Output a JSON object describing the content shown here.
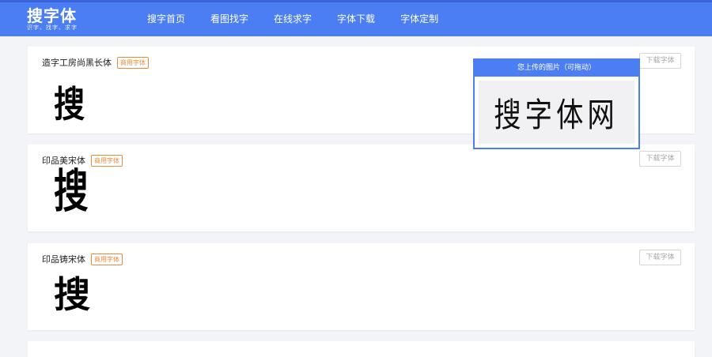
{
  "header": {
    "logo_main": "搜字体",
    "logo_sub": "识字、找字、求字",
    "nav": [
      "搜字首页",
      "看图找字",
      "在线求字",
      "字体下载",
      "字体定制"
    ]
  },
  "fonts": [
    {
      "name": "造字工房尚黑长体",
      "badge": "商用字体",
      "sample": "搜",
      "download": "下载字体"
    },
    {
      "name": "印品美宋体",
      "badge": "商用字体",
      "sample": "搜",
      "download": "下载字体"
    },
    {
      "name": "印品铸宋体",
      "badge": "商用字体",
      "sample": "搜",
      "download": "下载字体"
    }
  ],
  "upload_panel": {
    "title": "您上传的图片（可拖动）",
    "image_text": "搜字体网"
  },
  "colors": {
    "accent": "#4b7ef3",
    "badge": "#e88a3c",
    "background": "#f3f4f8"
  }
}
